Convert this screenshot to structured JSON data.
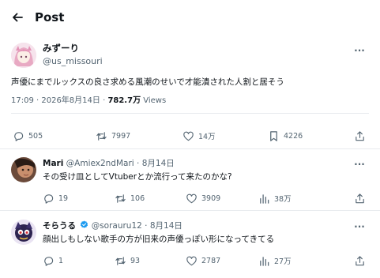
{
  "header": {
    "title": "Post"
  },
  "post": {
    "author_name": "みずーり",
    "author_handle": "@us_missouri",
    "text": "声優にまでルックスの良さ求める風潮のせいで才能潰された人割と居そう",
    "timestamp": "17:09 · 2026年8月14日 · ",
    "views_count": "782.7万",
    "views_label": " Views",
    "actions": {
      "replies": "505",
      "reposts": "7997",
      "likes": "14万",
      "bookmarks": "4226"
    }
  },
  "replies": [
    {
      "name": "Mari",
      "handle_date": "@Amiex2ndMari · 8月14日",
      "text": "その受け皿としてVtuberとか流行って来たのかな?",
      "verified": false,
      "actions": {
        "replies": "19",
        "reposts": "106",
        "likes": "3909",
        "views": "38万"
      }
    },
    {
      "name": "そらうる",
      "handle_date": "@sorauru12 · 8月14日",
      "text": "顔出しもしない歌手の方が旧来の声優っぽい形になってきてる",
      "verified": true,
      "actions": {
        "replies": "1",
        "reposts": "93",
        "likes": "2787",
        "views": "27万"
      }
    }
  ],
  "colors": {
    "text": "#0f1419",
    "secondary": "#536471",
    "verified": "#1d9bf0",
    "border": "#e8ebee"
  },
  "icons": [
    "back-arrow-icon",
    "more-icon",
    "reply-icon",
    "repost-icon",
    "like-icon",
    "bookmark-icon",
    "share-icon",
    "views-icon",
    "verified-icon"
  ]
}
